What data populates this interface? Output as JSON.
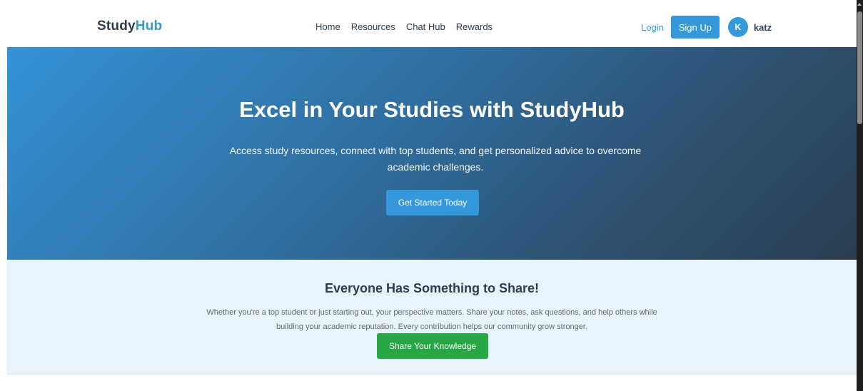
{
  "navbar": {
    "brand_prefix": "Study",
    "brand_suffix": "Hub",
    "links": [
      "Home",
      "Resources",
      "Chat Hub",
      "Rewards"
    ],
    "login_label": "Login",
    "signup_label": "Sign Up",
    "user": {
      "avatar_initial": "K",
      "username": "katz"
    }
  },
  "hero": {
    "title": "Excel in Your Studies with StudyHub",
    "subtitle": "Access study resources, connect with top students, and get personalized advice to overcome academic challenges.",
    "cta_label": "Get Started Today"
  },
  "share": {
    "title": "Everyone Has Something to Share!",
    "text": "Whether you're a top student or just starting out, your perspective matters. Share your notes, ask questions, and help others while building your academic reputation. Every contribution helps our community grow stronger.",
    "cta_label": "Share Your Knowledge"
  },
  "colors": {
    "primary": "#3498db",
    "dark": "#2c3e50",
    "success": "#28a745",
    "share_bg": "#e8f4fb"
  },
  "icons": {
    "scroll_up": "scroll-up-arrow-icon"
  }
}
